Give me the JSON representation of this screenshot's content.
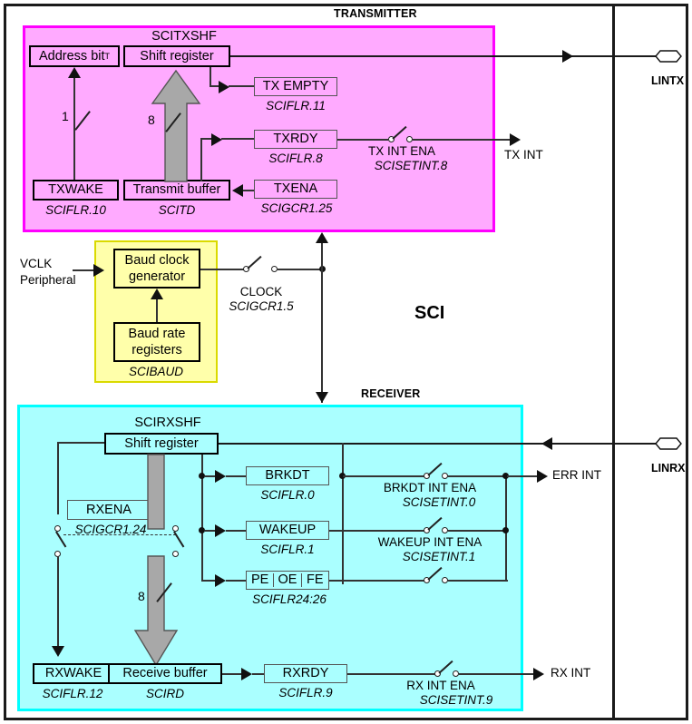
{
  "diagram": {
    "title": "SCI",
    "sections": {
      "transmitter": "TRANSMITTER",
      "receiver": "RECEIVER"
    }
  },
  "transmitter": {
    "shift_register_name": "SCITXSHF",
    "address_bit": {
      "label": "Address bit",
      "superscript": "T"
    },
    "shift_register": {
      "label": "Shift register"
    },
    "txwake": {
      "label": "TXWAKE",
      "reg": "SCIFLR.10"
    },
    "transmit_buffer": {
      "label": "Transmit buffer",
      "reg": "SCITD"
    },
    "tx_empty": {
      "label": "TX EMPTY",
      "reg": "SCIFLR.11"
    },
    "txrdy": {
      "label": "TXRDY",
      "reg": "SCIFLR.8"
    },
    "txena": {
      "label": "TXENA",
      "reg": "SCIGCR1.25"
    },
    "tx_int_ena": {
      "label": "TX INT ENA",
      "reg": "SCISETINT.8"
    },
    "tx_int_out": "TX INT",
    "bus_widths": {
      "address": "1",
      "data": "8"
    }
  },
  "baud": {
    "clock_in": {
      "line1": "VCLK",
      "line2": "Peripheral"
    },
    "baud_clock_generator": {
      "line1": "Baud clock",
      "line2": "generator"
    },
    "baud_rate_registers": {
      "line1": "Baud rate",
      "line2": "registers"
    },
    "group_reg": "SCIBAUD",
    "clock_switch": {
      "label": "CLOCK",
      "reg": "SCIGCR1.5"
    }
  },
  "receiver": {
    "shift_register_name": "SCIRXSHF",
    "shift_register": {
      "label": "Shift register"
    },
    "rxena": {
      "label": "RXENA",
      "reg": "SCIGCR1.24"
    },
    "rxwake": {
      "label": "RXWAKE",
      "reg": "SCIFLR.12"
    },
    "receive_buffer": {
      "label": "Receive buffer",
      "reg": "SCIRD"
    },
    "brkdt": {
      "label": "BRKDT",
      "reg": "SCIFLR.0"
    },
    "wakeup": {
      "label": "WAKEUP",
      "reg": "SCIFLR.1"
    },
    "errflags": {
      "pe": "PE",
      "oe": "OE",
      "fe": "FE",
      "reg": "SCIFLR24:26"
    },
    "rxrdy": {
      "label": "RXRDY",
      "reg": "SCIFLR.9"
    },
    "brkdt_int_ena": {
      "label": "BRKDT INT ENA",
      "reg": "SCISETINT.0"
    },
    "wakeup_int_ena": {
      "label": "WAKEUP INT ENA",
      "reg": "SCISETINT.1"
    },
    "rx_int_ena": {
      "label": "RX INT ENA",
      "reg": "SCISETINT.9"
    },
    "err_int_out": "ERR INT",
    "rx_int_out": "RX INT",
    "bus_widths": {
      "data": "8"
    }
  },
  "pins": {
    "lintx": "LINTX",
    "linrx": "LINRX"
  },
  "colors": {
    "transmitter_fill": "#ffaaff",
    "transmitter_border": "#ff00ff",
    "receiver_fill": "#aaffff",
    "receiver_border": "#00ffff",
    "baud_fill": "#ffffaa",
    "baud_border": "#dada00",
    "bus_arrow": "#a8a8a8",
    "wire": "#333333"
  }
}
